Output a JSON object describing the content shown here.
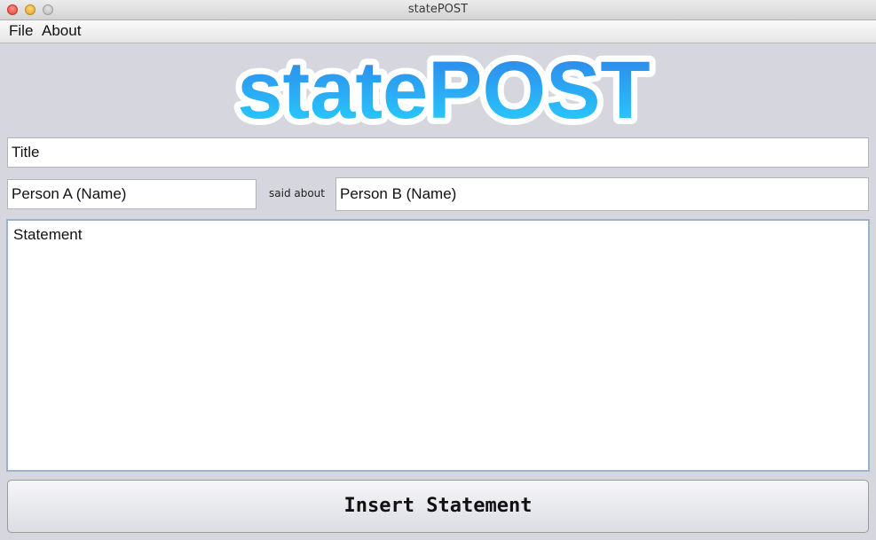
{
  "window": {
    "title": "statePOST"
  },
  "menu": {
    "items": [
      "File",
      "About"
    ]
  },
  "logo": {
    "text_part1": "state",
    "text_part2": "POST",
    "colors": {
      "gradient_top": "#2f7fe8",
      "gradient_bottom": "#27d4ff",
      "outline": "#ffffff"
    }
  },
  "form": {
    "title_value": "Title",
    "person_a_value": "Person A (Name)",
    "said_about_label": "said about",
    "person_b_value": "Person B (Name)",
    "statement_value": "Statement",
    "insert_button_label": "Insert Statement"
  },
  "colors": {
    "background": "#d6d7de",
    "focus_border": "#9bb3cc"
  }
}
